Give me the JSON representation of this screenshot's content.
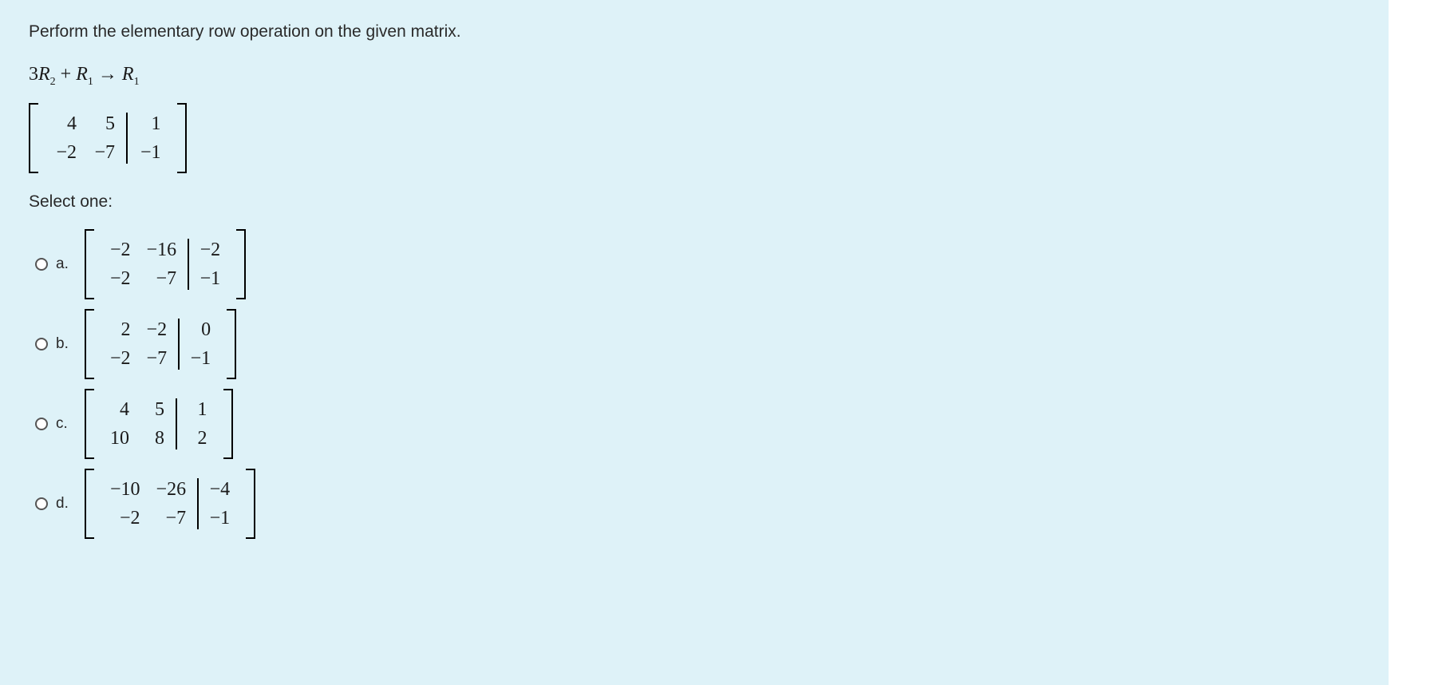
{
  "question": {
    "prompt": "Perform the elementary row operation on the given matrix.",
    "operation_plain": "3R2 + R1 → R1",
    "matrix": {
      "rows": [
        {
          "c1": "4",
          "c2": "5",
          "aug": "1"
        },
        {
          "c1": "−2",
          "c2": "−7",
          "aug": "−1"
        }
      ]
    },
    "select_label": "Select one:",
    "options": [
      {
        "letter": "a.",
        "rows": [
          {
            "c1": "−2",
            "c2": "−16",
            "aug": "−2"
          },
          {
            "c1": "−2",
            "c2": "−7",
            "aug": "−1"
          }
        ]
      },
      {
        "letter": "b.",
        "rows": [
          {
            "c1": "2",
            "c2": "−2",
            "aug": "0"
          },
          {
            "c1": "−2",
            "c2": "−7",
            "aug": "−1"
          }
        ]
      },
      {
        "letter": "c.",
        "rows": [
          {
            "c1": "4",
            "c2": "5",
            "aug": "1"
          },
          {
            "c1": "10",
            "c2": "8",
            "aug": "2"
          }
        ]
      },
      {
        "letter": "d.",
        "rows": [
          {
            "c1": "−10",
            "c2": "−26",
            "aug": "−4"
          },
          {
            "c1": "−2",
            "c2": "−7",
            "aug": "−1"
          }
        ]
      }
    ]
  },
  "chart_data": {
    "type": "table",
    "description": "Augmented 2x3 matrix and four 2x3 answer-choice matrices",
    "operation": "3R2 + R1 -> R1",
    "given_matrix": [
      [
        4,
        5,
        1
      ],
      [
        -2,
        -7,
        -1
      ]
    ],
    "choices": {
      "a": [
        [
          -2,
          -16,
          -2
        ],
        [
          -2,
          -7,
          -1
        ]
      ],
      "b": [
        [
          2,
          -2,
          0
        ],
        [
          -2,
          -7,
          -1
        ]
      ],
      "c": [
        [
          4,
          5,
          1
        ],
        [
          10,
          8,
          2
        ]
      ],
      "d": [
        [
          -10,
          -26,
          -4
        ],
        [
          -2,
          -7,
          -1
        ]
      ]
    }
  }
}
